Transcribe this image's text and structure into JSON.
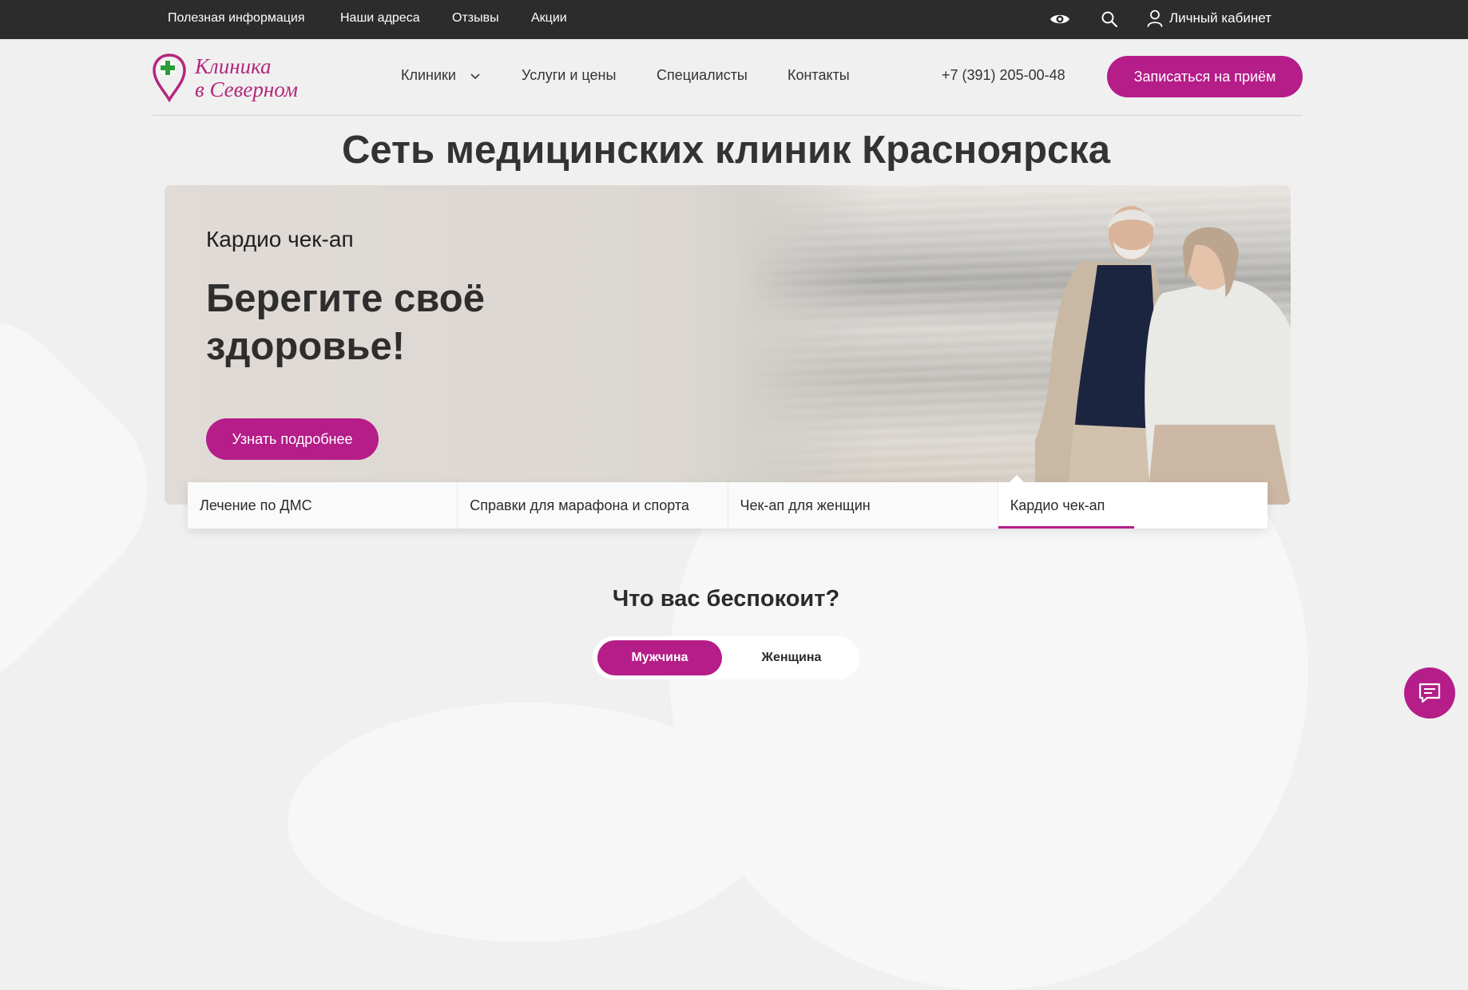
{
  "topbar": {
    "links": [
      "Полезная информация",
      "Наши адреса",
      "Отзывы",
      "Акции"
    ],
    "cabinet_label": "Личный кабинет",
    "icons": [
      "eye-icon",
      "search-icon",
      "user-icon"
    ]
  },
  "header": {
    "logo_line1": "Клиника",
    "logo_line2": "в Северном",
    "nav": {
      "clinics": "Клиники",
      "services": "Услуги и цены",
      "specialists": "Специалисты",
      "contacts": "Контакты"
    },
    "phone": "+7 (391) 205-00-48",
    "cta": "Записаться на приём"
  },
  "page_title": "Сеть медицинских клиник Красноярска",
  "hero": {
    "subtitle": "Кардио чек-ап",
    "title": "Берегите своё здоровье!",
    "button": "Узнать подробнее"
  },
  "tabs": [
    {
      "label": "Лечение по ДМС",
      "active": false
    },
    {
      "label": "Справки для марафона и спорта",
      "active": false
    },
    {
      "label": "Чек-ап для женщин",
      "active": false
    },
    {
      "label": "Кардио чек-ап",
      "active": true
    }
  ],
  "concern": {
    "title": "Что вас беспокоит?",
    "options": [
      "Мужчина",
      "Женщина"
    ],
    "selected": "Мужчина"
  },
  "colors": {
    "accent": "#b51d89",
    "topbar_bg": "#2c2c2c",
    "page_bg": "#f0f0f0",
    "logo_green": "#2a9d3a"
  }
}
